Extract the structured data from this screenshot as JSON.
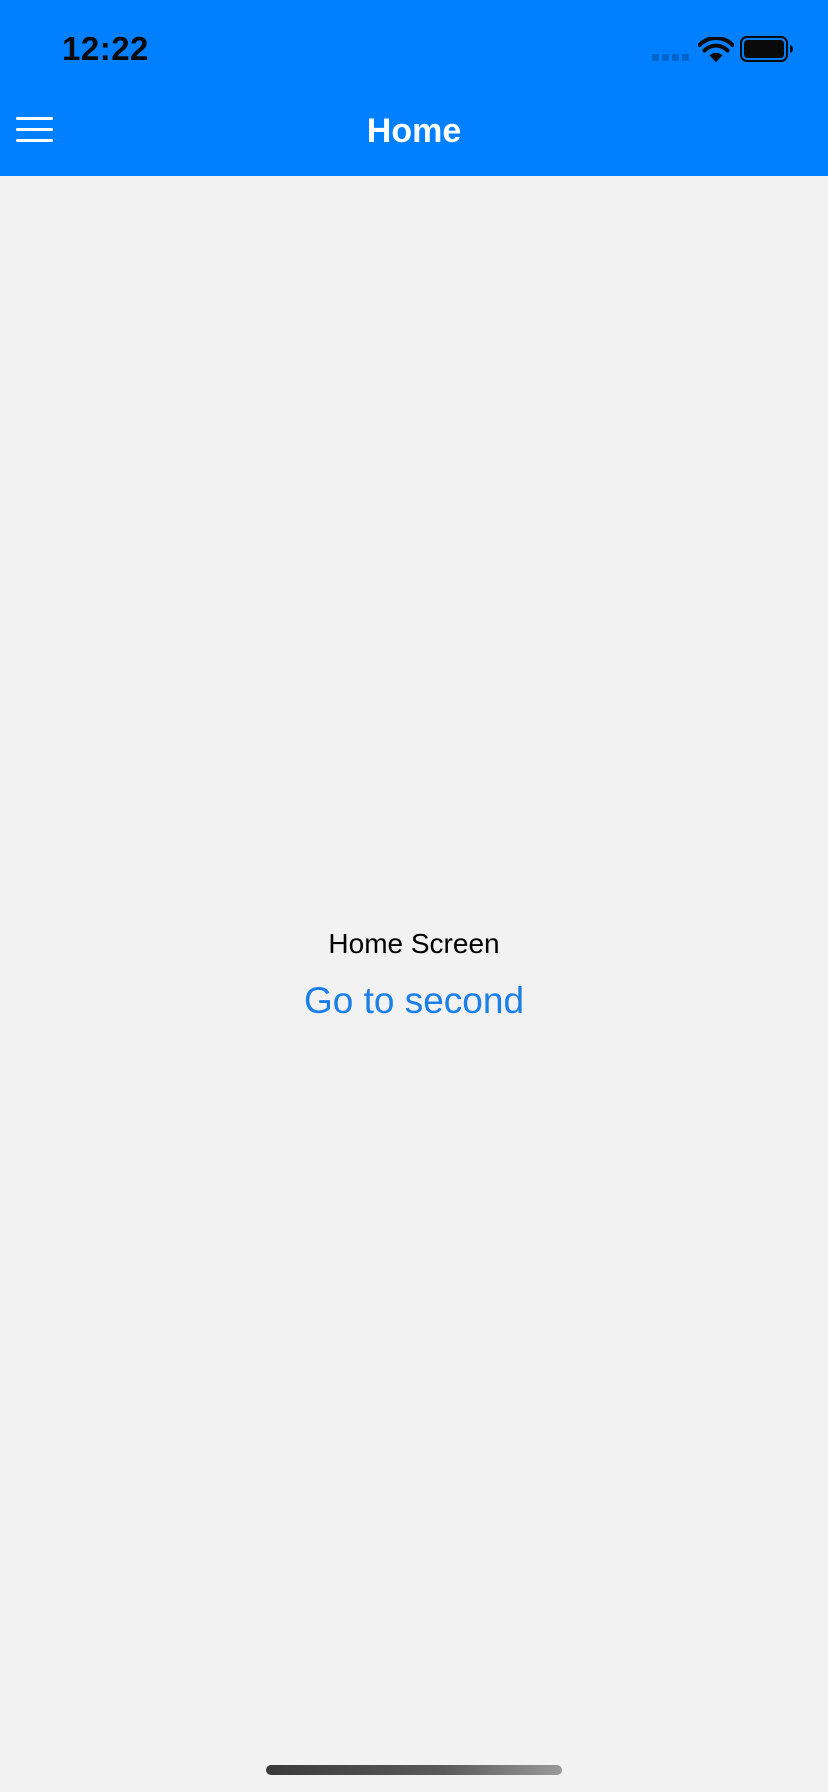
{
  "status_bar": {
    "time": "12:22",
    "signal_icon": "cellular-signal-icon",
    "wifi_icon": "wifi-icon",
    "battery_icon": "battery-icon",
    "battery_level": 1.0
  },
  "nav": {
    "title": "Home",
    "menu_icon": "hamburger-menu-icon",
    "background_color": "#0080ff"
  },
  "content": {
    "label": "Home Screen",
    "link_text": "Go to second",
    "link_color": "#1a7fe8",
    "background_color": "#f2f2f2"
  }
}
